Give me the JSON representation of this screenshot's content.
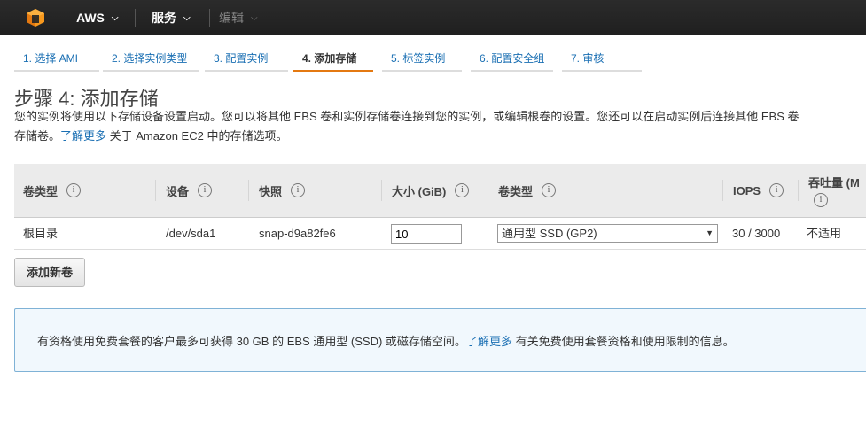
{
  "navbar": {
    "brand": "AWS",
    "services": "服务",
    "edit": "编辑"
  },
  "steps": [
    {
      "label": "1. 选择 AMI",
      "active": false
    },
    {
      "label": "2. 选择实例类型",
      "active": false
    },
    {
      "label": "3. 配置实例",
      "active": false
    },
    {
      "label": "4. 添加存储",
      "active": true
    },
    {
      "label": "5. 标签实例",
      "active": false
    },
    {
      "label": "6. 配置安全组",
      "active": false
    },
    {
      "label": "7. 审核",
      "active": false
    }
  ],
  "page": {
    "title": "步骤 4: 添加存储",
    "desc_line1": "您的实例将使用以下存储设备设置启动。您可以将其他 EBS 卷和实例存储卷连接到您的实例，或编辑根卷的设置。您还可以在启动实例后连接其他 EBS 卷",
    "desc_line2_pre": "存储卷。",
    "desc_link": "了解更多",
    "desc_line2_post": " 关于 Amazon EC2 中的存储选项。"
  },
  "table": {
    "headers": {
      "volume_type": "卷类型",
      "device": "设备",
      "snapshot": "快照",
      "size": "大小 (GiB)",
      "ebs_type": "卷类型",
      "iops": "IOPS",
      "throughput": "吞吐量 (M"
    },
    "row": {
      "volume_type": "根目录",
      "device": "/dev/sda1",
      "snapshot": "snap-d9a82fe6",
      "size": "10",
      "ebs_type": "通用型 SSD (GP2)",
      "iops": "30 / 3000",
      "throughput": "不适用"
    },
    "info_glyph": "i"
  },
  "add_volume_button": "添加新卷",
  "info_box": {
    "text_pre": "有资格使用免费套餐的客户最多可获得 30 GB 的 EBS 通用型 (SSD) 或磁存储空间。",
    "link": "了解更多",
    "text_post": " 有关免费使用套餐资格和使用限制的信息。"
  },
  "colors": {
    "navbar_bg": "#232323",
    "link": "#1a6fb3",
    "active_step_underline": "#e47911",
    "info_box_bg": "#f1f8fd",
    "info_box_border": "#7fb2d6"
  }
}
